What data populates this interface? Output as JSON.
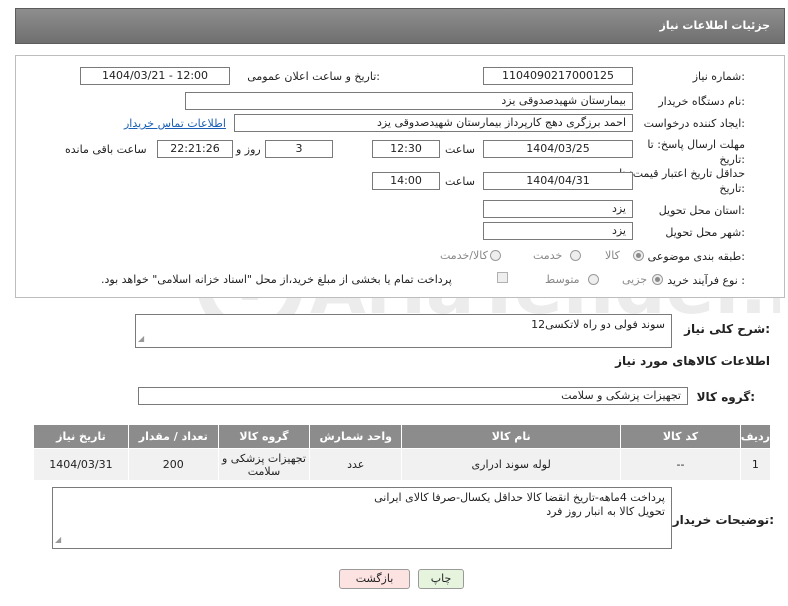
{
  "header": {
    "title": "جزئیات اطلاعات نیاز"
  },
  "form": {
    "need_number_label": "شماره نیاز:",
    "need_number": "1104090217000125",
    "announce_label": "تاریخ و ساعت اعلان عمومی:",
    "announce_value": "1404/03/21 - 12:00",
    "buyer_label": "نام دستگاه خریدار:",
    "buyer_value": "بیمارستان شهیدصدوقی یزد",
    "creator_label": "ایجاد کننده درخواست:",
    "creator_value": "احمد برزگری دهج کارپرداز بیمارستان شهیدصدوقی یزد",
    "contact_link": "اطلاعات تماس خریدار",
    "deadline_label": "مهلت ارسال پاسخ: تا تاریخ:",
    "deadline_date": "1404/03/25",
    "time_label": "ساعت",
    "deadline_time": "12:30",
    "days_value": "3",
    "days_label": "روز و",
    "remaining_time": "22:21:26",
    "remaining_label": "ساعت باقی مانده",
    "price_validity_label": "حداقل تاریخ اعتبار قیمت: تا تاریخ:",
    "price_validity_date": "1404/04/31",
    "price_validity_time": "14:00",
    "province_label": "استان محل تحویل:",
    "province_value": "یزد",
    "city_label": "شهر محل تحویل:",
    "city_value": "یزد",
    "category_label": "طبقه بندی موضوعی:",
    "category_options": [
      "کالا",
      "خدمت",
      "کالا/خدمت"
    ],
    "process_label": "نوع فرآیند خرید :",
    "process_options": [
      "جزیی",
      "متوسط"
    ],
    "payment_note": "پرداخت تمام یا بخشی از مبلغ خرید،از محل \"اسناد خزانه اسلامی\" خواهد بود."
  },
  "description": {
    "label": "شرح کلی نیاز:",
    "value": "سوند فولی دو راه لاتکسی12"
  },
  "goods": {
    "section_title": "اطلاعات کالاهای مورد نیاز",
    "group_label": "گروه کالا:",
    "group_value": "تجهیزات پزشکی و سلامت",
    "columns": [
      "ردیف",
      "کد کالا",
      "نام کالا",
      "واحد شمارش",
      "گروه کالا",
      "تعداد / مقدار",
      "تاریخ نیاز"
    ],
    "rows": [
      {
        "row": "1",
        "code": "--",
        "name": "لوله سوند ادراری",
        "unit": "عدد",
        "group": "تجهیزات پزشکی و سلامت",
        "qty": "200",
        "date": "1404/03/31"
      }
    ]
  },
  "buyer_notes": {
    "label": "توضیحات خریدار:",
    "line1": "پرداخت 4ماهه-تاریخ انقضا کالا حداقل یکسال-صرفا کالای ایرانی",
    "line2": "تحویل کالا به انبار روز فرد"
  },
  "buttons": {
    "print": "چاپ",
    "back": "بازگشت"
  },
  "watermark": {
    "text": "AriaTender.net"
  },
  "colors": {
    "header": "#7f7f7f",
    "link": "#1a5fb4",
    "back_button": "#fde2e2",
    "print_button": "#e6f4de"
  }
}
